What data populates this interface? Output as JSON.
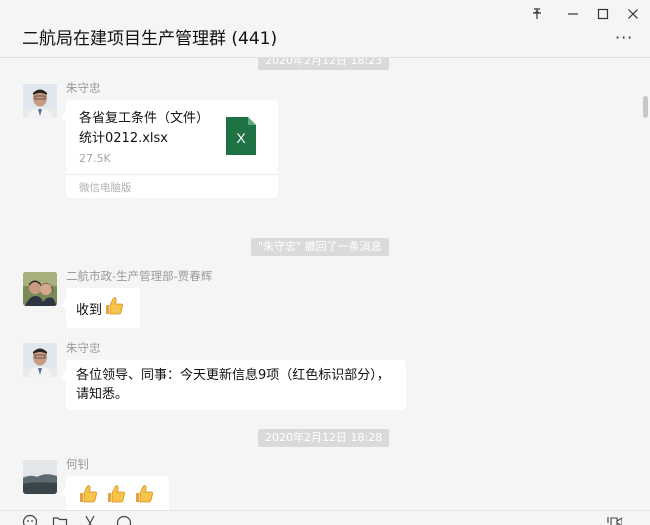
{
  "window": {
    "title": "二航局在建项目生产管理群 (441)",
    "controls": {
      "pin": "⊼",
      "minimize": "—",
      "maximize": "☐",
      "close": "✕",
      "more": "···"
    }
  },
  "chat": {
    "timestamps": {
      "top": "2020年2月12日 18:23",
      "middle": "2020年2月12日 18:28"
    },
    "messages": [
      {
        "sender": "朱守忠",
        "type": "file",
        "file_name": "各省复工条件（文件）统计0212.xlsx",
        "file_size": "27.5K",
        "source": "微信电脑版",
        "file_icon_letter": "X"
      },
      {
        "type": "system",
        "text": "\"朱守忠\" 撤回了一条消息"
      },
      {
        "sender": "二航市政-生产管理部-贾春辉",
        "type": "text",
        "text": "收到"
      },
      {
        "sender": "朱守忠",
        "type": "text",
        "text": "各位领导、同事：今天更新信息9项（红色标识部分），请知悉。"
      },
      {
        "sender": "何钊",
        "type": "emoji",
        "emoji_count": 3
      }
    ]
  },
  "toolbar": {
    "icons": [
      "emoji-icon",
      "folder-icon",
      "scissors-icon",
      "chat-history-icon",
      "video-call-icon"
    ]
  },
  "colors": {
    "background": "#f5f5f5",
    "bubble": "#ffffff",
    "excel_green": "#1f7244",
    "pill": "#dadada"
  }
}
